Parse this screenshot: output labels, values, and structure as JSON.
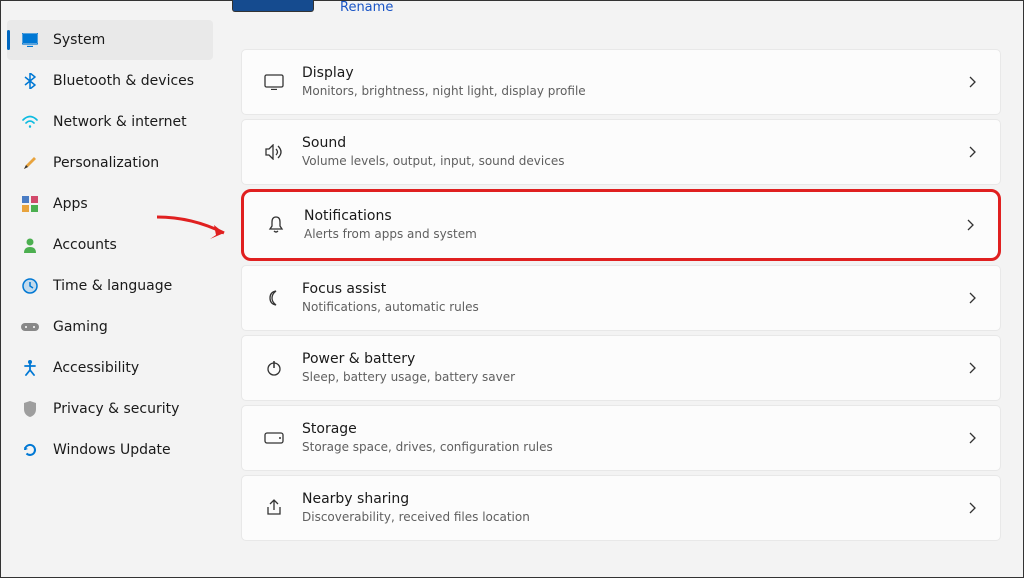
{
  "header": {
    "rename_link": "Rename"
  },
  "sidebar": {
    "items": [
      {
        "label": "System",
        "icon": "system-icon",
        "active": true,
        "color": "#0078d4"
      },
      {
        "label": "Bluetooth & devices",
        "icon": "bluetooth-icon",
        "color": "#0078d4"
      },
      {
        "label": "Network & internet",
        "icon": "wifi-icon",
        "color": "#0dbbe0"
      },
      {
        "label": "Personalization",
        "icon": "paint-icon",
        "color": "#e8a33d"
      },
      {
        "label": "Apps",
        "icon": "apps-icon",
        "color": "#d24a6b"
      },
      {
        "label": "Accounts",
        "icon": "accounts-icon",
        "color": "#4caf50"
      },
      {
        "label": "Time & language",
        "icon": "time-icon",
        "color": "#0078d4"
      },
      {
        "label": "Gaming",
        "icon": "gaming-icon",
        "color": "#888"
      },
      {
        "label": "Accessibility",
        "icon": "accessibility-icon",
        "color": "#0078d4"
      },
      {
        "label": "Privacy & security",
        "icon": "shield-icon",
        "color": "#888"
      },
      {
        "label": "Windows Update",
        "icon": "update-icon",
        "color": "#0078d4"
      }
    ]
  },
  "settings": {
    "items": [
      {
        "title": "Display",
        "desc": "Monitors, brightness, night light, display profile",
        "icon": "display-icon",
        "highlighted": false
      },
      {
        "title": "Sound",
        "desc": "Volume levels, output, input, sound devices",
        "icon": "sound-icon",
        "highlighted": false
      },
      {
        "title": "Notifications",
        "desc": "Alerts from apps and system",
        "icon": "bell-icon",
        "highlighted": true
      },
      {
        "title": "Focus assist",
        "desc": "Notifications, automatic rules",
        "icon": "moon-icon",
        "highlighted": false
      },
      {
        "title": "Power & battery",
        "desc": "Sleep, battery usage, battery saver",
        "icon": "power-icon",
        "highlighted": false
      },
      {
        "title": "Storage",
        "desc": "Storage space, drives, configuration rules",
        "icon": "storage-icon",
        "highlighted": false
      },
      {
        "title": "Nearby sharing",
        "desc": "Discoverability, received files location",
        "icon": "share-icon",
        "highlighted": false
      }
    ]
  }
}
